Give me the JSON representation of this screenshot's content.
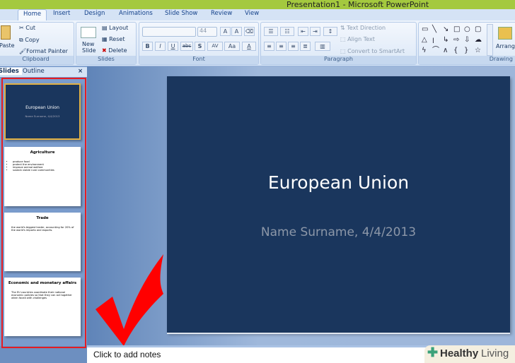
{
  "window": {
    "title": "Presentation1 - Microsoft PowerPoint"
  },
  "tabs": [
    "Home",
    "Insert",
    "Design",
    "Animations",
    "Slide Show",
    "Review",
    "View"
  ],
  "clipboard": {
    "label": "Clipboard",
    "paste": "Paste",
    "cut": "Cut",
    "copy": "Copy",
    "format_painter": "Format Painter"
  },
  "slides_group": {
    "label": "Slides",
    "new_slide_1": "New",
    "new_slide_2": "Slide",
    "layout": "Layout",
    "reset": "Reset",
    "delete": "Delete"
  },
  "font": {
    "label": "Font",
    "font_name": "",
    "font_size": "44",
    "bold": "B",
    "italic": "I",
    "underline": "U",
    "strike": "abc",
    "shadow": "S",
    "spacing": "AV",
    "case": "Aa",
    "color": "A",
    "grow": "A",
    "shrink": "A"
  },
  "paragraph": {
    "label": "Paragraph",
    "text_direction": "Text Direction",
    "align_text": "Align Text",
    "smartart": "Convert to SmartArt"
  },
  "drawing": {
    "label": "Drawing",
    "arrange": "Arrange",
    "shapes": [
      "▭",
      "╲",
      "↘",
      "□",
      "○",
      "▢",
      "△",
      "ꞁ",
      "↳",
      "⇨",
      "⇩",
      "☁",
      "ϟ",
      "⌒",
      "∧",
      "{",
      "}",
      "☆"
    ]
  },
  "panel": {
    "tab_slides": "Slides",
    "tab_outline": "Outline",
    "close": "×"
  },
  "thumbnails": [
    {
      "title": "European Union",
      "subtitle": "Name Surname, 4/4/2013"
    },
    {
      "title": "Agriculture",
      "bullets": [
        "produce food",
        "protect the environment",
        "improve animal welfare",
        "sustain viable rural communities"
      ]
    },
    {
      "title": "Trade",
      "text": "the world's biggest trader, accounting for 20% of the world's imports and exports."
    },
    {
      "title": "Economic and monetary affairs",
      "text": "The EU countries coordinate their national economic policies so that they can act together when faced with challenges"
    }
  ],
  "slide": {
    "title": "European Union",
    "subtitle": "Name Surname, 4/4/2013"
  },
  "notes": {
    "placeholder": "Click to add notes"
  },
  "watermark": {
    "word1": "Healthy",
    "word2": "Living"
  },
  "colors": {
    "highlight": "#e51c23",
    "slide_bg": "#1a365d",
    "accent_green": "#a4c93f"
  }
}
